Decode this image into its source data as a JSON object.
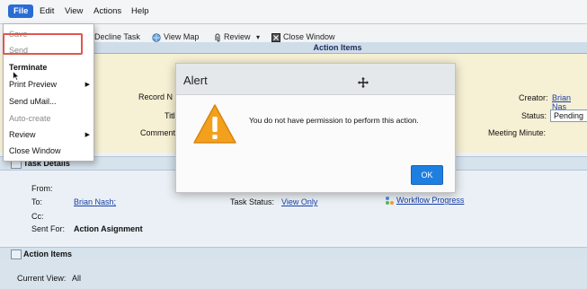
{
  "menubar": {
    "items": [
      "File",
      "Edit",
      "View",
      "Actions",
      "Help"
    ]
  },
  "toolbar": {
    "decline": "Decline Task",
    "view_map": "View Map",
    "review": "Review",
    "review_arrow": "▾",
    "close_window": "Close Window"
  },
  "section_title": "Action Items",
  "form": {
    "record_label": "Record N",
    "title_label": "Titl",
    "comments_label": "Comment",
    "creator_label": "Creator:",
    "creator_value": "Brian Nas",
    "status_label": "Status:",
    "status_value": "Pending",
    "meeting_label": "Meeting Minute:"
  },
  "task_details": {
    "header": "Task Details",
    "from_label": "From:",
    "to_label": "To:",
    "to_value": "Brian Nash;",
    "cc_label": "Cc:",
    "sent_for_label": "Sent For:",
    "sent_for_value": "Action Asignment",
    "task_status_label": "Task Status:",
    "task_status_value": "View Only",
    "workflow_progress": "Workflow Progress"
  },
  "action_items_section": {
    "header": "Action Items",
    "current_view_label": "Current View:",
    "current_view_value": "All"
  },
  "file_menu": {
    "items": [
      "Save",
      "Send",
      "Terminate",
      "Print Preview",
      "Send uMail...",
      "Auto-create",
      "Review",
      "Close Window"
    ]
  },
  "alert": {
    "title": "Alert",
    "message": "You do not have permission to perform this action.",
    "ok": "OK"
  },
  "colors": {
    "accent": "#1f7fe0",
    "highlight": "#e0574d",
    "warning": "#f3a11c"
  }
}
